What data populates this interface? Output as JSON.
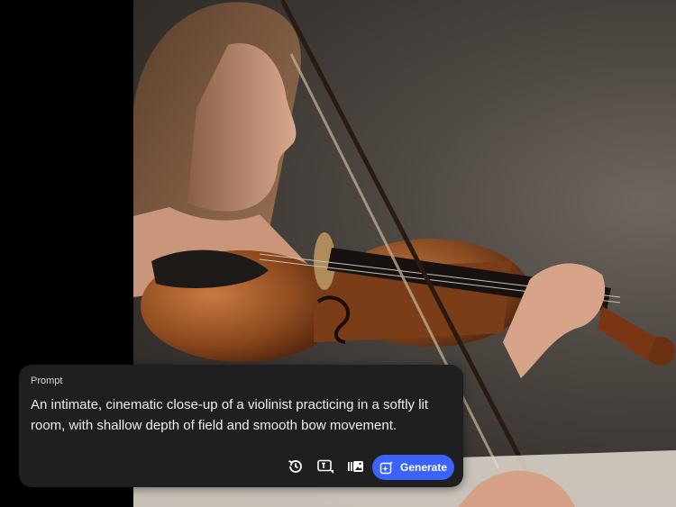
{
  "prompt": {
    "label": "Prompt",
    "text": "An intimate, cinematic close-up of a violinist practicing in a softly lit room, with shallow depth of field and smooth bow movement."
  },
  "toolbar": {
    "history_icon": "history-icon",
    "style_icon": "text-style-icon",
    "reference_icon": "reference-image-icon",
    "generate_label": "Generate",
    "generate_icon": "sparkle-icon",
    "accent": "#3b63fb"
  },
  "image": {
    "subject": "photo"
  }
}
